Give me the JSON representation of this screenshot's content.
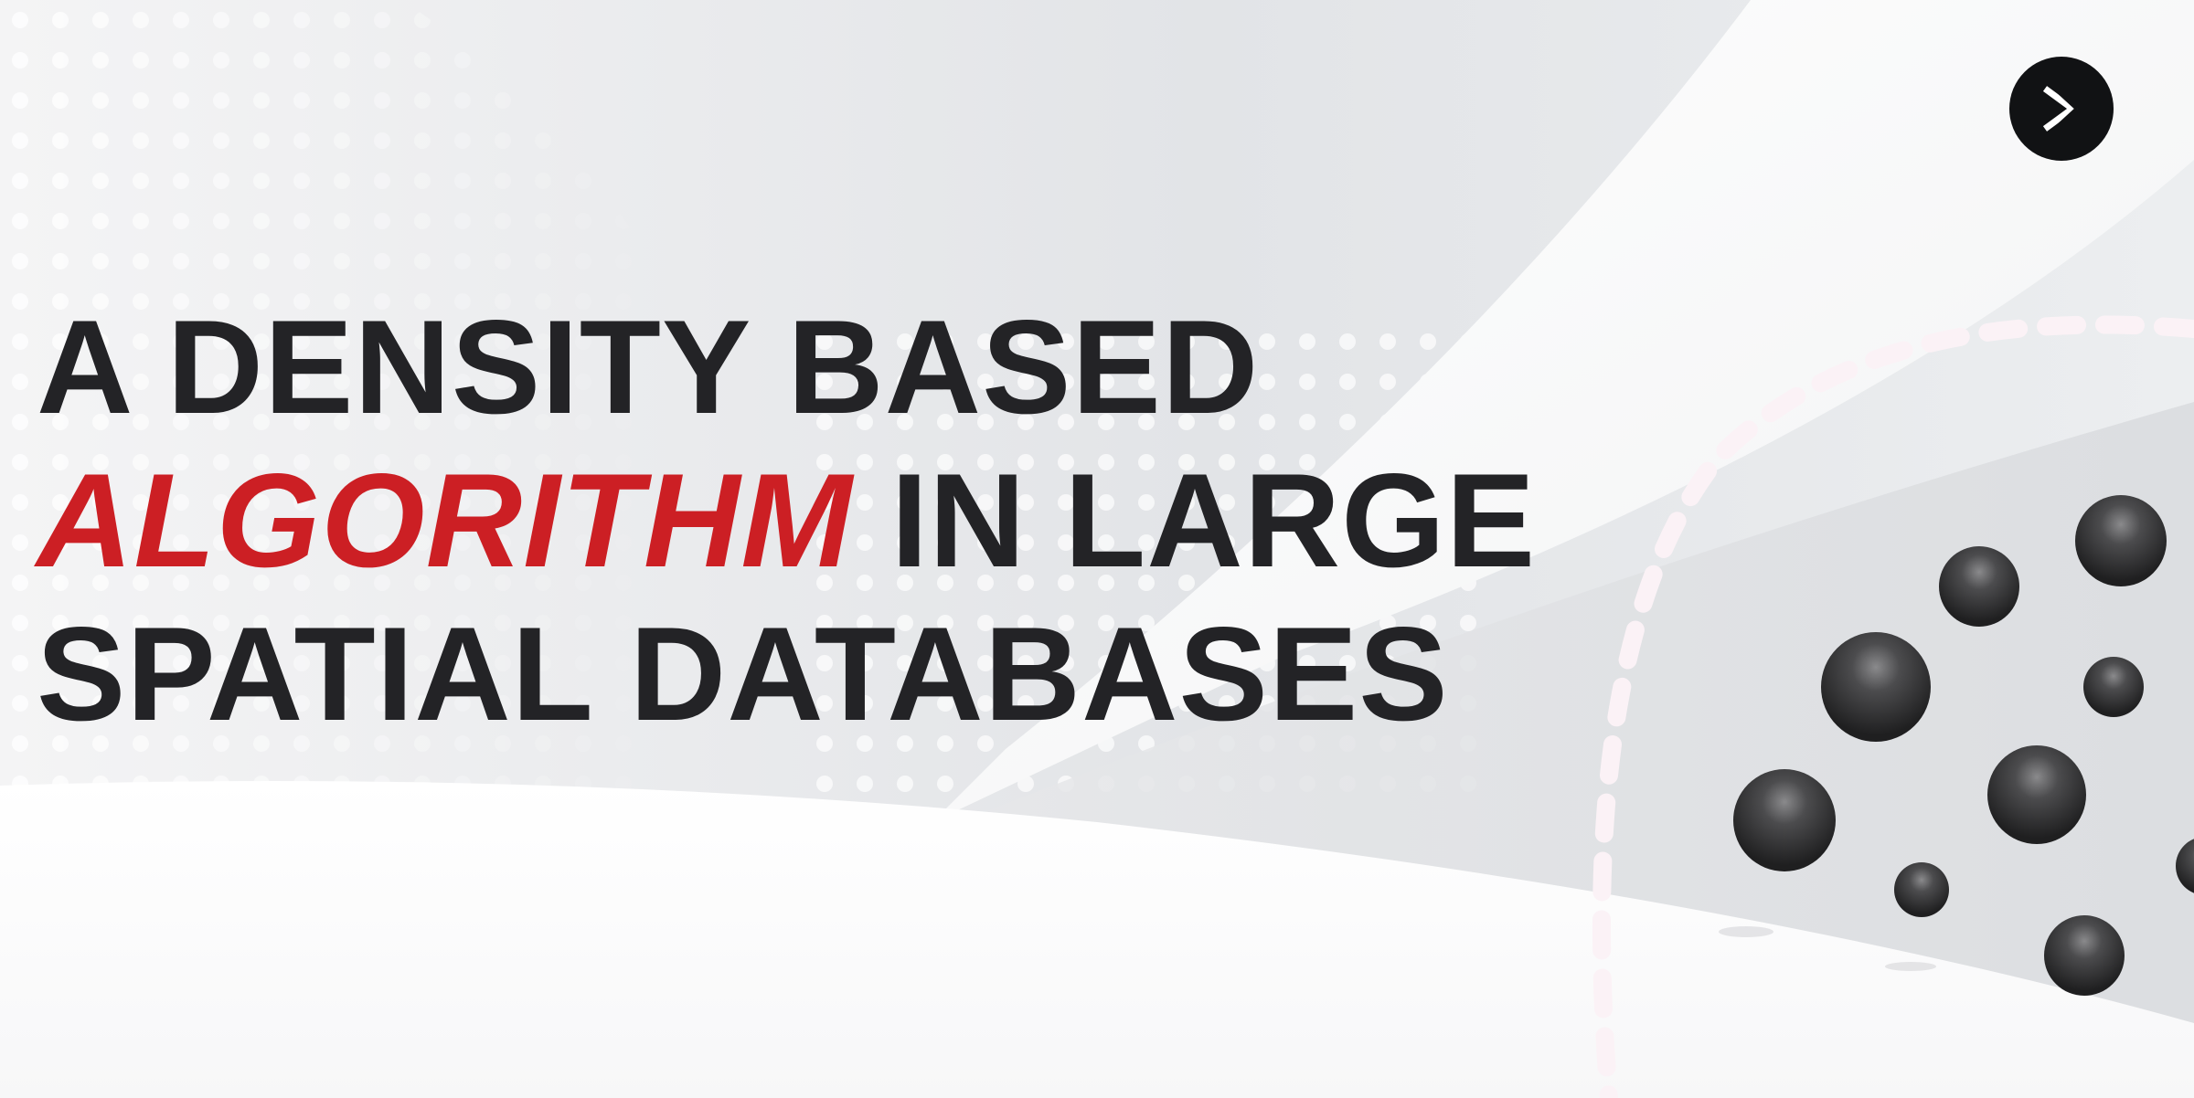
{
  "title": {
    "line1": "A DENSITY BASED",
    "line2_accent": "ALGORITHM",
    "line2_rest": " IN LARGE",
    "line3": "SPATIAL DATABASES"
  },
  "colors": {
    "text": "#232326",
    "accent": "#cc1f24",
    "button": "#111214",
    "background": "#eceef0"
  },
  "next_button": {
    "icon": "chevron-right-icon"
  }
}
